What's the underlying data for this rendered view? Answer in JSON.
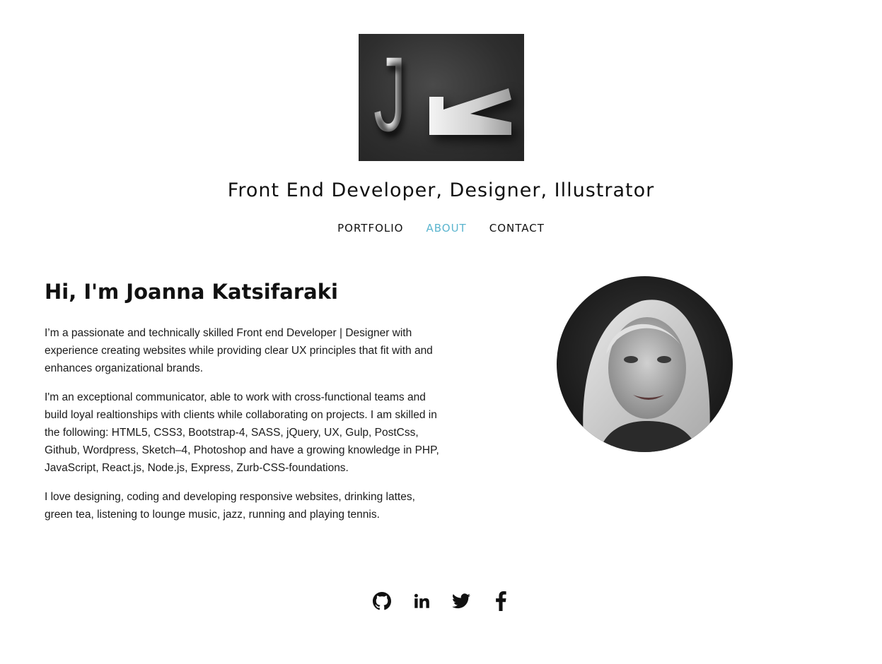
{
  "logo": {
    "letter_j": "J",
    "letter_k": "K"
  },
  "header": {
    "tagline": "Front End Developer, Designer, Illustrator"
  },
  "nav": {
    "items": [
      {
        "label": "PORTFOLIO",
        "active": false
      },
      {
        "label": "ABOUT",
        "active": true
      },
      {
        "label": "CONTACT",
        "active": false
      }
    ],
    "active_color": "#5bb5cf"
  },
  "about": {
    "heading": "Hi, I'm Joanna Katsifaraki",
    "paragraphs": [
      "I’m a passionate and technically skilled Front end Developer | Designer with experience creating websites while providing clear UX principles that fit with and enhances organizational brands.",
      "I'm an exceptional communicator, able to work with cross-functional teams and build loyal realtionships with clients while collaborating on projects. I am skilled in the following: HTML5, CSS3, Bootstrap-4, SASS, jQuery, UX, Gulp, PostCss, Github, Wordpress, Sketch–4, Photoshop and have a growing knowledge in PHP, JavaScript, React.js, Node.js, Express, Zurb-CSS-foundations.",
      "I love designing, coding and developing responsive websites, drinking lattes, green tea, listening to lounge music, jazz, running and playing tennis."
    ]
  },
  "social": {
    "icons": [
      "github-icon",
      "linkedin-icon",
      "twitter-icon",
      "facebook-icon"
    ]
  }
}
